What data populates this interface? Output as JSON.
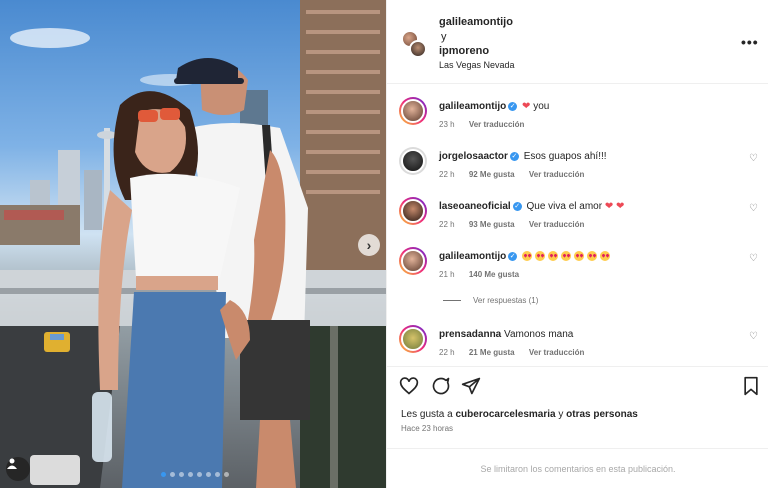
{
  "post": {
    "author1": "galileamontijo",
    "connector": "y",
    "author2": "ipmoreno",
    "location": "Las Vegas Nevada",
    "more_icon": "more-horizontal-icon"
  },
  "comments": [
    {
      "user": "galileamontijo",
      "verified": true,
      "text": "you",
      "time": "23 h",
      "likes": "",
      "reply_label": "Ver traducción",
      "has_like_button": false
    },
    {
      "user": "jorgelosaactor",
      "verified": true,
      "text": "Esos guapos ahí!!!",
      "time": "22 h",
      "likes": "92 Me gusta",
      "reply_label": "Ver traducción",
      "has_like_button": true
    },
    {
      "user": "laseoaneoficial",
      "verified": true,
      "text": "Que viva el amor",
      "time": "22 h",
      "likes": "93 Me gusta",
      "reply_label": "Ver traducción",
      "has_like_button": true
    },
    {
      "user": "galileamontijo",
      "verified": true,
      "text": "",
      "emoji_count": 7,
      "time": "21 h",
      "likes": "140 Me gusta",
      "reply_label": "",
      "has_like_button": true
    },
    {
      "user": "prensadanna",
      "verified": false,
      "text": "Vamonos mana",
      "time": "22 h",
      "likes": "21 Me gusta",
      "reply_label": "Ver traducción",
      "has_like_button": true
    }
  ],
  "replies_toggle": "Ver respuestas (1)",
  "actions": {
    "like_icon": "heart-outline-icon",
    "comment_icon": "comment-bubble-icon",
    "share_icon": "paper-plane-icon",
    "save_icon": "bookmark-icon"
  },
  "likes_summary": {
    "prefix": "Les gusta a",
    "user": "cuberocarcelesmaria",
    "middle": "y",
    "suffix": "otras personas"
  },
  "posted_ago": "Hace 23 horas",
  "comments_limited": "Se limitaron los comentarios en esta publicación.",
  "carousel": {
    "total": 8,
    "current": 1
  },
  "colors": {
    "verified": "#3897f0",
    "heart": "#ed4956",
    "muted": "#737373",
    "story_ring": "#ee2a7b"
  }
}
